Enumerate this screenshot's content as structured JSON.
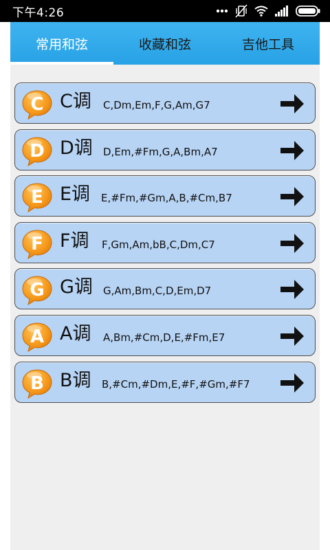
{
  "status_bar": {
    "time": "下午4:26",
    "icons": [
      "more-dots-icon",
      "muted-vibrate-icon",
      "wifi-icon",
      "signal-icon",
      "battery-icon"
    ]
  },
  "tabs": [
    {
      "label": "常用和弦",
      "active": true
    },
    {
      "label": "收藏和弦",
      "active": false
    },
    {
      "label": "吉他工具",
      "active": false
    }
  ],
  "colors": {
    "tab_bar": "#27a2e6",
    "row_background": "#b7d4f5",
    "badge_orange": "#f38d12",
    "content_background": "#efefef"
  },
  "keys": [
    {
      "letter": "C",
      "name": "C调",
      "chords": "C,Dm,Em,F,G,Am,G7"
    },
    {
      "letter": "D",
      "name": "D调",
      "chords": "D,Em,#Fm,G,A,Bm,A7"
    },
    {
      "letter": "E",
      "name": "E调",
      "chords": "E,#Fm,#Gm,A,B,#Cm,B7"
    },
    {
      "letter": "F",
      "name": "F调",
      "chords": "F,Gm,Am,bB,C,Dm,C7"
    },
    {
      "letter": "G",
      "name": "G调",
      "chords": "G,Am,Bm,C,D,Em,D7"
    },
    {
      "letter": "A",
      "name": "A调",
      "chords": "A,Bm,#Cm,D,E,#Fm,E7"
    },
    {
      "letter": "B",
      "name": "B调",
      "chords": "B,#Cm,#Dm,E,#F,#Gm,#F7"
    }
  ]
}
